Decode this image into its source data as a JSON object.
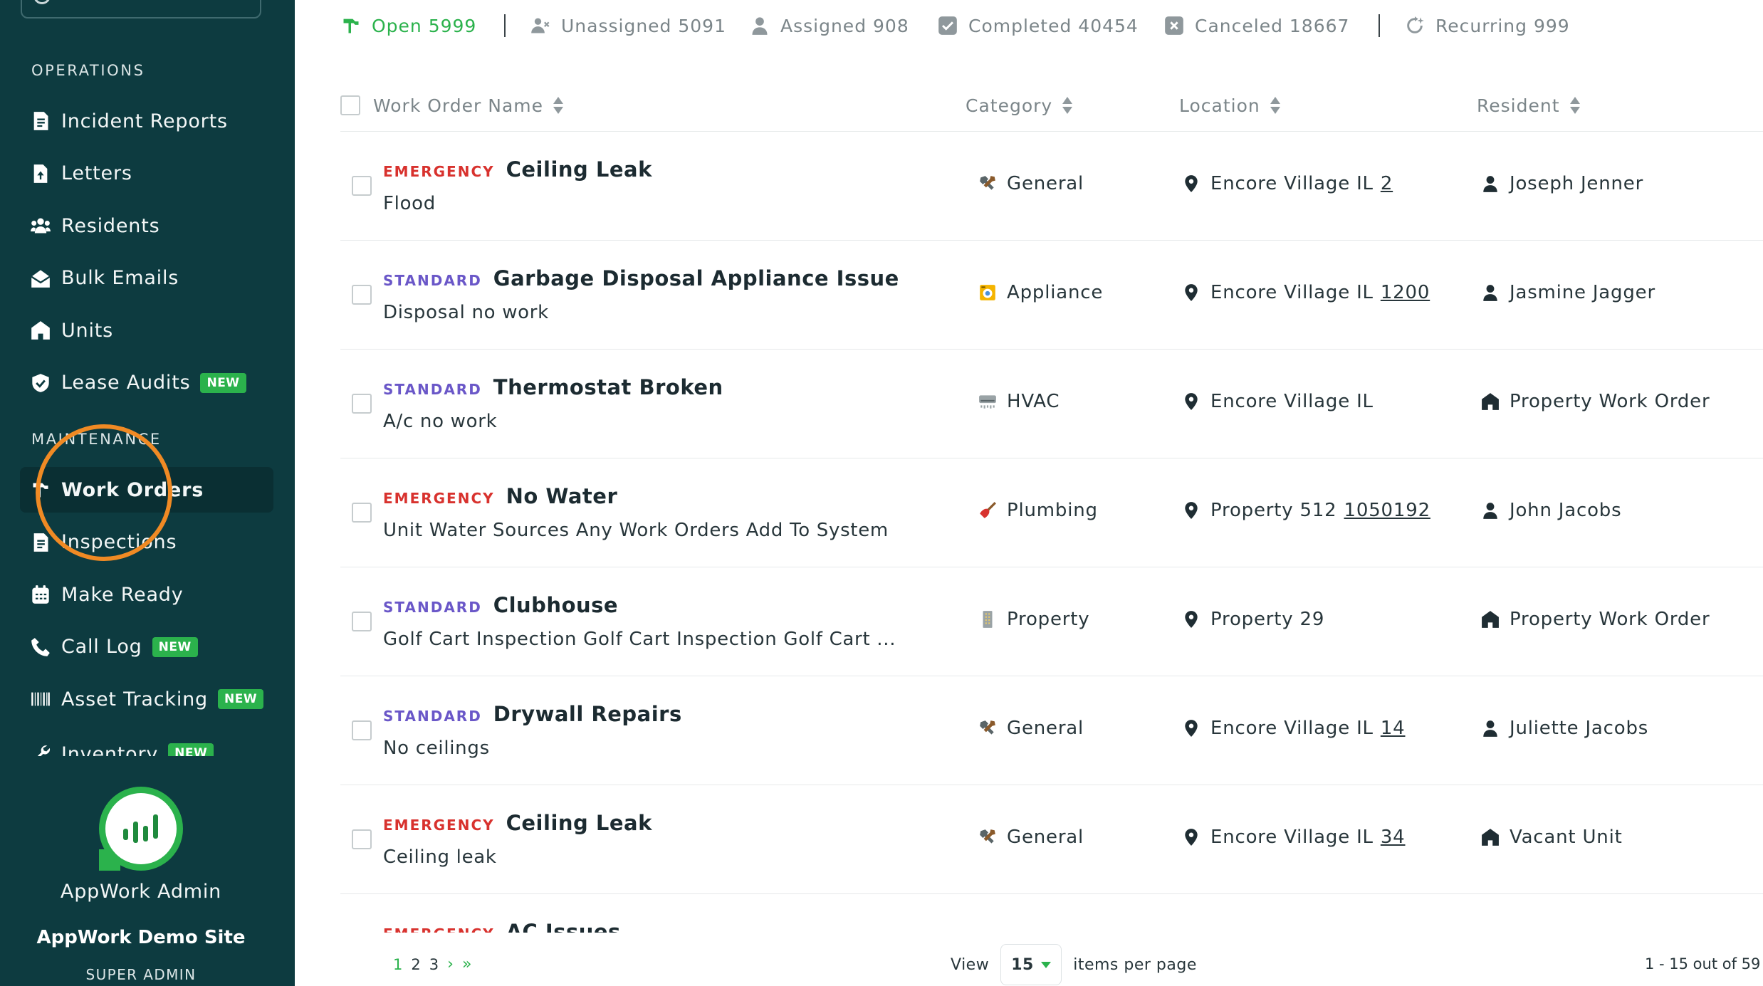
{
  "sidebar": {
    "sections": {
      "operations": "OPERATIONS",
      "maintenance": "MAINTENANCE"
    },
    "operations_items": [
      {
        "label": "Incident Reports",
        "icon": "document-icon"
      },
      {
        "label": "Letters",
        "icon": "letter-upload-icon"
      },
      {
        "label": "Residents",
        "icon": "people-icon"
      },
      {
        "label": "Bulk Emails",
        "icon": "envelope-open-icon"
      },
      {
        "label": "Units",
        "icon": "home-icon"
      },
      {
        "label": "Lease Audits",
        "icon": "shield-check-icon",
        "badge": "NEW"
      }
    ],
    "maintenance_items": [
      {
        "label": "Work Orders",
        "icon": "hammer-icon",
        "active": true
      },
      {
        "label": "Inspections",
        "icon": "document-icon"
      },
      {
        "label": "Make Ready",
        "icon": "calendar-icon"
      },
      {
        "label": "Call Log",
        "icon": "phone-icon",
        "badge": "NEW"
      },
      {
        "label": "Asset Tracking",
        "icon": "barcode-icon",
        "badge": "NEW"
      },
      {
        "label": "Inventory",
        "icon": "wrench-icon",
        "badge": "NEW"
      }
    ],
    "user_name": "AppWork Admin",
    "site_name": "AppWork Demo Site",
    "role": "SUPER ADMIN"
  },
  "filters": [
    {
      "label": "Open 5999",
      "icon": "hammer-icon",
      "active": true
    },
    {
      "label": "Unassigned 5091",
      "icon": "user-x-icon"
    },
    {
      "label": "Assigned 908",
      "icon": "user-icon"
    },
    {
      "label": "Completed 40454",
      "icon": "check-square-icon"
    },
    {
      "label": "Canceled 18667",
      "icon": "x-square-icon"
    },
    {
      "label": "Recurring 999",
      "icon": "recurring-icon"
    }
  ],
  "columns": {
    "name": "Work Order Name",
    "category": "Category",
    "location": "Location",
    "resident": "Resident"
  },
  "rows": [
    {
      "priority": "EMERGENCY",
      "title": "Ceiling Leak",
      "desc": "Flood",
      "category": "General",
      "cat_icon": "tools-icon",
      "location": "Encore Village IL",
      "unit": "2",
      "resident": "Joseph Jenner",
      "res_icon": "person-icon"
    },
    {
      "priority": "STANDARD",
      "title": "Garbage Disposal Appliance Issue",
      "desc": "Disposal no work",
      "category": "Appliance",
      "cat_icon": "washer-icon",
      "location": "Encore Village IL",
      "unit": "1200",
      "resident": "Jasmine Jagger",
      "res_icon": "person-icon"
    },
    {
      "priority": "STANDARD",
      "title": "Thermostat Broken",
      "desc": "A/c no work",
      "category": "HVAC",
      "cat_icon": "hvac-icon",
      "location": "Encore Village IL",
      "unit": "",
      "resident": "Property Work Order",
      "res_icon": "building-icon"
    },
    {
      "priority": "EMERGENCY",
      "title": "No Water",
      "desc": "Unit Water Sources Any Work Orders Add To System",
      "category": "Plumbing",
      "cat_icon": "plunger-icon",
      "location": "Property 512",
      "unit": "1050192",
      "resident": "John Jacobs",
      "res_icon": "person-icon"
    },
    {
      "priority": "STANDARD",
      "title": "Clubhouse",
      "desc": "Golf Cart Inspection Golf Cart Inspection Golf Cart ...",
      "category": "Property",
      "cat_icon": "building-icon",
      "location": "Property 29",
      "unit": "",
      "resident": "Property Work Order",
      "res_icon": "building-icon"
    },
    {
      "priority": "STANDARD",
      "title": "Drywall Repairs",
      "desc": "No ceilings",
      "category": "General",
      "cat_icon": "tools-icon",
      "location": "Encore Village IL",
      "unit": "14",
      "resident": "Juliette Jacobs",
      "res_icon": "person-icon"
    },
    {
      "priority": "EMERGENCY",
      "title": "Ceiling Leak",
      "desc": "Ceiling leak",
      "category": "General",
      "cat_icon": "tools-icon",
      "location": "Encore Village IL",
      "unit": "34",
      "resident": "Vacant Unit",
      "res_icon": "building-icon"
    },
    {
      "priority": "EMERGENCY",
      "title": "AC Issues",
      "desc": "",
      "category": "",
      "cat_icon": "",
      "location": "",
      "unit": "",
      "resident": "",
      "res_icon": ""
    }
  ],
  "pagination": {
    "pages": [
      "1",
      "2",
      "3"
    ],
    "next": "›",
    "last": "»",
    "view_label": "View",
    "per_page": "15",
    "per_page_suffix": "items per page",
    "range": "1 - 15 out of 59"
  },
  "colors": {
    "sidebar_bg": "#0d3b40",
    "accent_green": "#2bb24c",
    "emergency": "#d8322e",
    "standard": "#6a57c8",
    "highlight_ring": "#f08a24"
  }
}
